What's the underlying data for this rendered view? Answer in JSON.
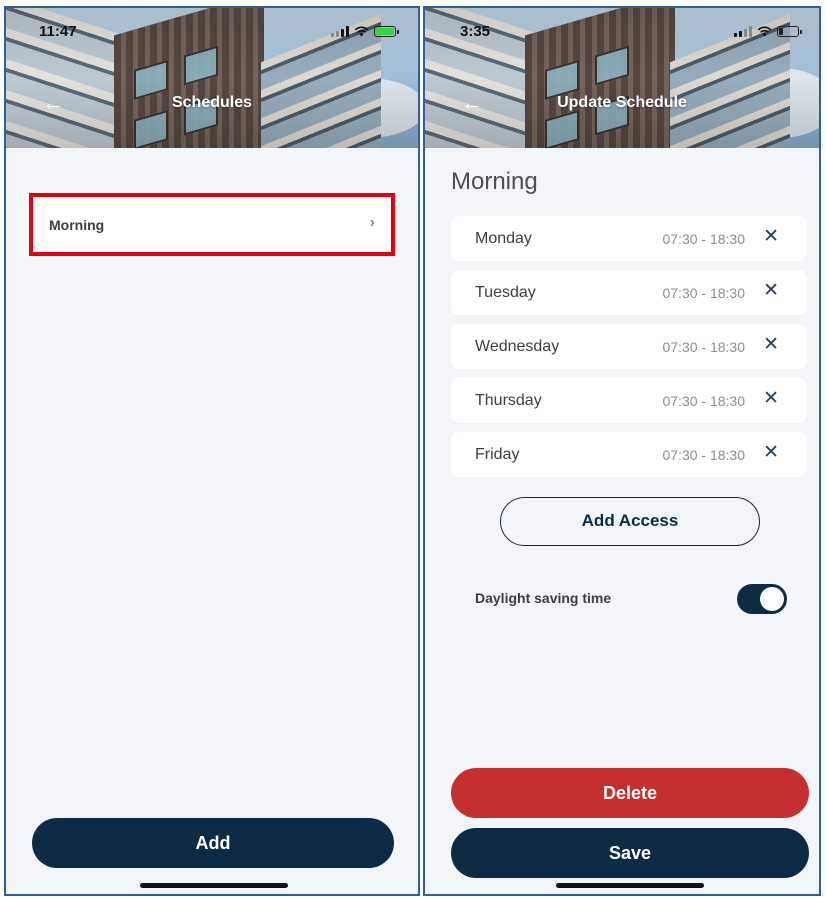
{
  "left_screen": {
    "status_time": "11:47",
    "header_title": "Schedules",
    "schedules": [
      {
        "label": "Morning"
      }
    ],
    "add_label": "Add"
  },
  "right_screen": {
    "status_time": "3:35",
    "header_title": "Update Schedule",
    "schedule_name": "Morning",
    "days": [
      {
        "day": "Monday",
        "time": "07:30 - 18:30"
      },
      {
        "day": "Tuesday",
        "time": "07:30 - 18:30"
      },
      {
        "day": "Wednesday",
        "time": "07:30 - 18:30"
      },
      {
        "day": "Thursday",
        "time": "07:30 - 18:30"
      },
      {
        "day": "Friday",
        "time": "07:30 - 18:30"
      }
    ],
    "add_access_label": "Add Access",
    "dst_label": "Daylight saving time",
    "dst_enabled": true,
    "delete_label": "Delete",
    "save_label": "Save"
  },
  "icons": {
    "back": "arrow-left-icon",
    "chevron": "chevron-right-icon",
    "remove": "close-icon",
    "signal": "cellular-signal-icon",
    "wifi": "wifi-icon",
    "battery": "battery-icon"
  },
  "colors": {
    "navy": "#0e2b46",
    "red": "#c62f2f",
    "highlight": "#e3000f",
    "battery_left": "#3bd14a",
    "background": "#f3f6f8"
  }
}
